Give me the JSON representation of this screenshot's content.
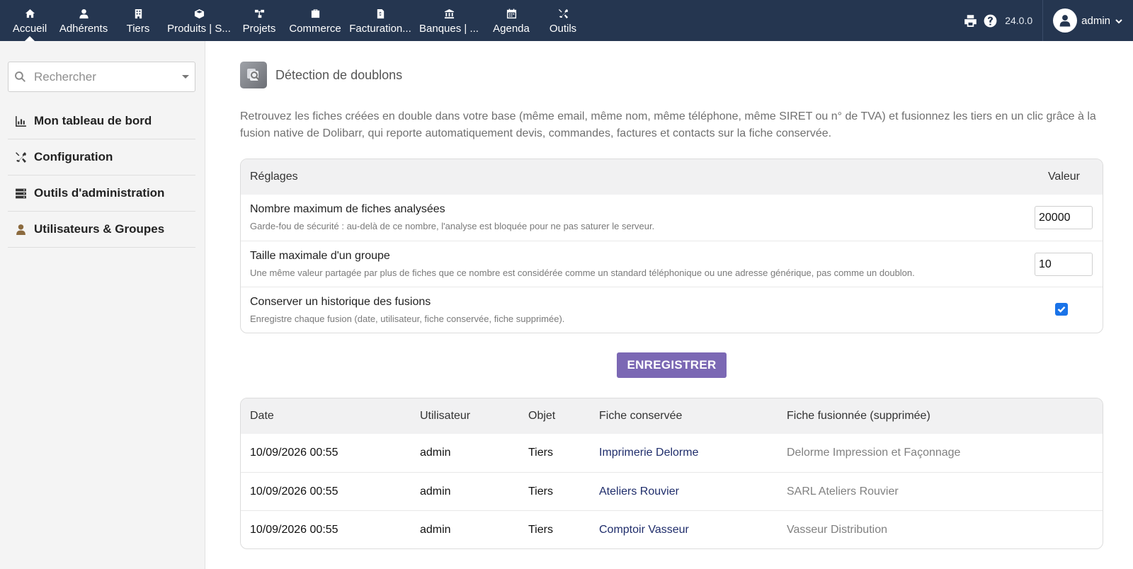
{
  "topnav": {
    "items": [
      {
        "label": "Accueil",
        "icon": "home-icon"
      },
      {
        "label": "Adhérents",
        "icon": "user-icon"
      },
      {
        "label": "Tiers",
        "icon": "building-icon"
      },
      {
        "label": "Produits | S...",
        "icon": "cube-icon"
      },
      {
        "label": "Projets",
        "icon": "sitemap-icon"
      },
      {
        "label": "Commerce",
        "icon": "suitcase-icon"
      },
      {
        "label": "Facturation...",
        "icon": "invoice-icon"
      },
      {
        "label": "Banques | ...",
        "icon": "bank-icon"
      },
      {
        "label": "Agenda",
        "icon": "calendar-icon"
      },
      {
        "label": "Outils",
        "icon": "tools-icon"
      }
    ],
    "active": "Accueil",
    "version": "24.0.0",
    "username": "admin"
  },
  "sidebar": {
    "search_placeholder": "Rechercher",
    "items": [
      {
        "label": "Mon tableau de bord",
        "icon": "chart-bar-icon"
      },
      {
        "label": "Configuration",
        "icon": "tools-icon"
      },
      {
        "label": "Outils d'administration",
        "icon": "server-icon"
      },
      {
        "label": "Utilisateurs & Groupes",
        "icon": "user-icon"
      }
    ]
  },
  "page": {
    "title": "Détection de doublons",
    "description": "Retrouvez les fiches créées en double dans votre base (même email, même nom, même téléphone, même SIRET ou n° de TVA) et fusionnez les tiers en un clic grâce à la fusion native de Dolibarr, qui reporte automatiquement devis, commandes, factures et contacts sur la fiche conservée."
  },
  "settings": {
    "header_left": "Réglages",
    "header_right": "Valeur",
    "rows": [
      {
        "title": "Nombre maximum de fiches analysées",
        "help": "Garde-fou de sécurité : au-delà de ce nombre, l'analyse est bloquée pour ne pas saturer le serveur.",
        "value": "20000"
      },
      {
        "title": "Taille maximale d'un groupe",
        "help": "Une même valeur partagée par plus de fiches que ce nombre est considérée comme un standard téléphonique ou une adresse générique, pas comme un doublon.",
        "value": "10"
      },
      {
        "title": "Conserver un historique des fusions",
        "help": "Enregistre chaque fusion (date, utilisateur, fiche conservée, fiche supprimée).",
        "checked": true
      }
    ]
  },
  "save_label": "ENREGISTRER",
  "history": {
    "columns": [
      "Date",
      "Utilisateur",
      "Objet",
      "Fiche conservée",
      "Fiche fusionnée (supprimée)"
    ],
    "rows": [
      [
        "10/09/2026 00:55",
        "admin",
        "Tiers",
        "Imprimerie Delorme",
        "Delorme Impression et Façonnage"
      ],
      [
        "10/09/2026 00:55",
        "admin",
        "Tiers",
        "Ateliers Rouvier",
        "SARL Ateliers Rouvier"
      ],
      [
        "10/09/2026 00:55",
        "admin",
        "Tiers",
        "Comptoir Vasseur",
        "Vasseur Distribution"
      ]
    ]
  },
  "colors": {
    "topbar": "#253650",
    "button": "#7b68b4",
    "link": "#1f2d6b",
    "checkbox": "#1a73e8"
  }
}
